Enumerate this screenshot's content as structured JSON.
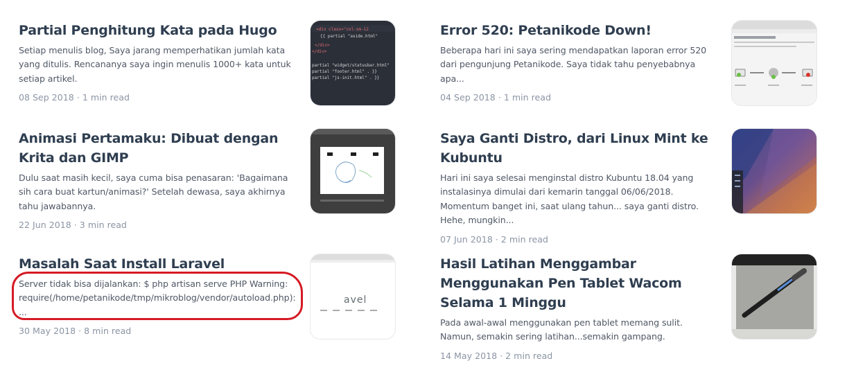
{
  "posts": [
    {
      "title": "Partial Penghitung Kata pada Hugo",
      "excerpt": "Setiap menulis blog, Saya jarang memperhatikan jumlah kata yang ditulis. Rencananya saya ingin menulis 1000+ kata untuk setiap artikel.",
      "date": "08 Sep 2018",
      "read_time": "1 min read",
      "thumb_icon": "code-editor-thumbnail"
    },
    {
      "title": "Error 520: Petanikode Down!",
      "excerpt": "Beberapa hari ini saya sering mendapatkan laporan error 520 dari pengunjung Petanikode. Saya tidak tahu penyebabnya apa...",
      "date": "04 Sep 2018",
      "read_time": "1 min read",
      "thumb_icon": "error-page-thumbnail"
    },
    {
      "title": "Animasi Pertamaku: Dibuat dengan Krita dan GIMP",
      "excerpt": "Dulu saat masih kecil, saya cuma bisa penasaran: 'Bagaimana sih cara buat kartun/animasi?' Setelah dewasa, saya akhirnya tahu jawabannya.",
      "date": "22 Jun 2018",
      "read_time": "3 min read",
      "thumb_icon": "animation-sketch-thumbnail"
    },
    {
      "title": "Saya Ganti Distro, dari Linux Mint ke Kubuntu",
      "excerpt": "Hari ini saya selesai menginstal distro Kubuntu 18.04 yang instalasinya dimulai dari kemarin tanggal 06/06/2018. Momentum banget ini, saat ulang tahun... saya ganti distro. Hehe, mungkin...",
      "date": "07 Jun 2018",
      "read_time": "2 min read",
      "thumb_icon": "kde-wallpaper-thumbnail"
    },
    {
      "title": "Masalah Saat Install Laravel",
      "excerpt": "Server tidak bisa dijalankan: $ php artisan serve PHP Warning: require(/home/petanikode/tmp/mikroblog/vendor/autoload.php): ...",
      "date": "30 May 2018",
      "read_time": "8 min read",
      "thumb_icon": "laravel-welcome-thumbnail",
      "thumb_text": "avel"
    },
    {
      "title": "Hasil Latihan Menggambar Menggunakan Pen Tablet Wacom Selama 1 Minggu",
      "excerpt": "Pada awal-awal menggunakan pen tablet memang sulit. Namun, semakin sering latihan...semakin gampang.",
      "date": "14 May 2018",
      "read_time": "2 min read",
      "thumb_icon": "pen-tablet-thumbnail"
    }
  ],
  "meta_separator": "·",
  "highlight_color": "#d51b24"
}
